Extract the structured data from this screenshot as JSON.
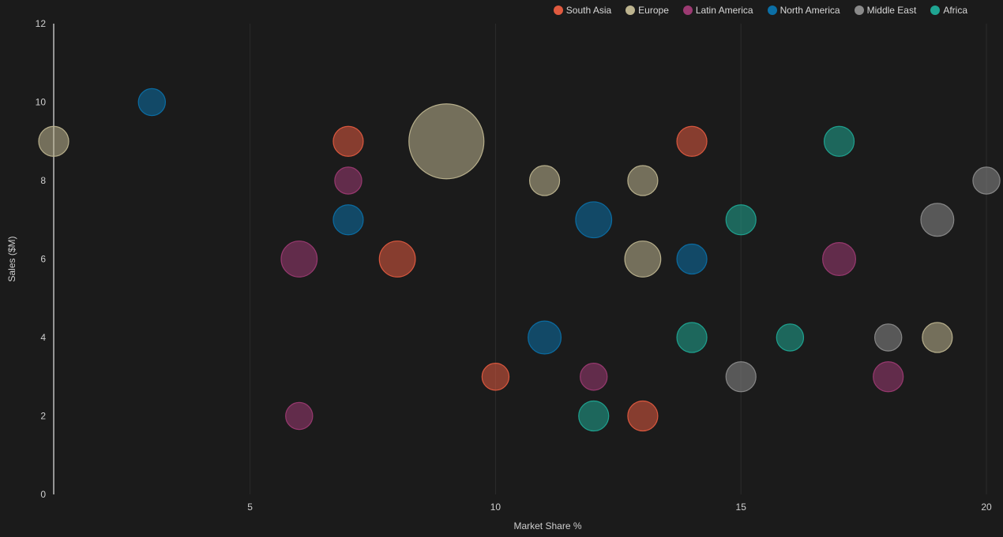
{
  "chart_data": {
    "type": "scatter",
    "subtype": "bubble",
    "xlabel": "Market Share %",
    "ylabel": "Sales ($M)",
    "xlim": [
      1,
      20
    ],
    "ylim": [
      0,
      12
    ],
    "x_ticks": [
      5,
      10,
      15,
      20
    ],
    "y_ticks": [
      0,
      2,
      4,
      6,
      8,
      10,
      12
    ],
    "grid": "vertical",
    "legend_position": "top-right",
    "series": [
      {
        "name": "South Asia",
        "color": "#e05a3f",
        "points": [
          {
            "x": 7,
            "y": 9,
            "size": 1.0
          },
          {
            "x": 8,
            "y": 6,
            "size": 1.2
          },
          {
            "x": 10,
            "y": 3,
            "size": 0.9
          },
          {
            "x": 13,
            "y": 2,
            "size": 1.0
          },
          {
            "x": 14,
            "y": 9,
            "size": 1.0
          }
        ]
      },
      {
        "name": "Europe",
        "color": "#bdb48f",
        "points": [
          {
            "x": 1,
            "y": 9,
            "size": 1.0
          },
          {
            "x": 9,
            "y": 9,
            "size": 2.5
          },
          {
            "x": 11,
            "y": 8,
            "size": 1.0
          },
          {
            "x": 13,
            "y": 8,
            "size": 1.0
          },
          {
            "x": 13,
            "y": 6,
            "size": 1.2
          },
          {
            "x": 19,
            "y": 4,
            "size": 1.0
          }
        ]
      },
      {
        "name": "Latin America",
        "color": "#9c3a72",
        "points": [
          {
            "x": 6,
            "y": 6,
            "size": 1.2
          },
          {
            "x": 6,
            "y": 2,
            "size": 0.9
          },
          {
            "x": 7,
            "y": 8,
            "size": 0.9
          },
          {
            "x": 12,
            "y": 3,
            "size": 0.9
          },
          {
            "x": 17,
            "y": 6,
            "size": 1.1
          },
          {
            "x": 18,
            "y": 3,
            "size": 1.0
          }
        ]
      },
      {
        "name": "North America",
        "color": "#0b6fa6",
        "points": [
          {
            "x": 3,
            "y": 10,
            "size": 0.9
          },
          {
            "x": 7,
            "y": 7,
            "size": 1.0
          },
          {
            "x": 11,
            "y": 4,
            "size": 1.1
          },
          {
            "x": 12,
            "y": 7,
            "size": 1.2
          },
          {
            "x": 14,
            "y": 6,
            "size": 1.0
          }
        ]
      },
      {
        "name": "Middle East",
        "color": "#8a8a8a",
        "points": [
          {
            "x": 15,
            "y": 3,
            "size": 1.0
          },
          {
            "x": 18,
            "y": 4,
            "size": 0.9
          },
          {
            "x": 19,
            "y": 7,
            "size": 1.1
          },
          {
            "x": 20,
            "y": 8,
            "size": 0.9
          }
        ]
      },
      {
        "name": "Africa",
        "color": "#1fa592",
        "points": [
          {
            "x": 12,
            "y": 2,
            "size": 1.0
          },
          {
            "x": 14,
            "y": 4,
            "size": 1.0
          },
          {
            "x": 15,
            "y": 7,
            "size": 1.0
          },
          {
            "x": 16,
            "y": 4,
            "size": 0.9
          },
          {
            "x": 17,
            "y": 9,
            "size": 1.0
          }
        ]
      }
    ]
  }
}
